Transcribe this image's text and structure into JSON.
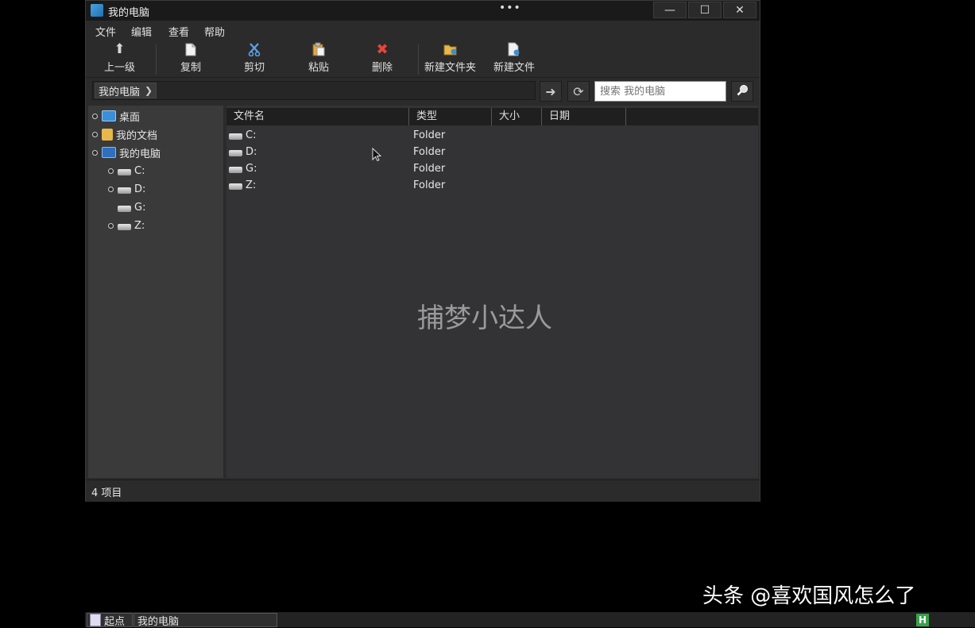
{
  "window": {
    "title": "我的电脑",
    "title_dots": "•••",
    "controls": {
      "minimize": "—",
      "maximize": "☐",
      "close": "✕"
    }
  },
  "menubar": [
    "文件",
    "编辑",
    "查看",
    "帮助"
  ],
  "toolbar": {
    "up": "上一级",
    "copy": "复制",
    "cut": "剪切",
    "paste": "粘贴",
    "delete": "删除",
    "new_folder": "新建文件夹",
    "new_file": "新建文件"
  },
  "address": {
    "breadcrumb": "我的电脑",
    "search_placeholder": "搜索 我的电脑"
  },
  "tree": {
    "desktop": "桌面",
    "my_documents": "我的文档",
    "my_computer": "我的电脑",
    "drives": [
      "C:",
      "D:",
      "G:",
      "Z:"
    ]
  },
  "list": {
    "columns": [
      "文件名",
      "类型",
      "大小",
      "日期"
    ],
    "rows": [
      {
        "name": "C:",
        "type": "Folder"
      },
      {
        "name": "D:",
        "type": "Folder"
      },
      {
        "name": "G:",
        "type": "Folder"
      },
      {
        "name": "Z:",
        "type": "Folder"
      }
    ]
  },
  "watermark": "捕梦小达人",
  "status": "4 项目",
  "taskbar": {
    "start": "起点",
    "task": "我的电脑"
  },
  "overlay_credit": "头条 @喜欢国风怎么了",
  "colors": {
    "delete_red": "#e8453c",
    "folder_yellow": "#e8b84a",
    "monitor_blue": "#3b8fd9"
  }
}
